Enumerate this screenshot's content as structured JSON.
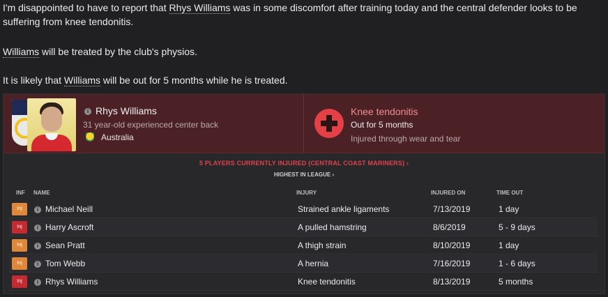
{
  "message": {
    "p1_before": "I'm disappointed to have to report that ",
    "p1_player": "Rhys Williams",
    "p1_after": " was in some discomfort after training today and the central defender looks to be suffering from knee tendonitis.",
    "p2_player": "Williams",
    "p2_after": " will be treated by the club's physios.",
    "p3_before": "It is likely that ",
    "p3_player": "Williams",
    "p3_after": " will be out for 5 months while he is treated."
  },
  "player": {
    "name": "Rhys Williams",
    "description": "31 year-old experienced center back",
    "nationality": "Australia",
    "photo_icon": "player-photo",
    "crest_icon": "club-crest"
  },
  "injury": {
    "title": "Knee tendonitis",
    "duration": "Out for 5 months",
    "cause": "Injured through wear and tear",
    "icon": "medical-cross-icon"
  },
  "squad": {
    "injured_count_label": "5 PLAYERS CURRENTLY INJURED (CENTRAL COAST MARINERS)",
    "chevron": "›",
    "league_label": "HIGHEST IN LEAGUE",
    "columns": {
      "inf": "INF",
      "name": "NAME",
      "injury": "INJURY",
      "injured_on": "INJURED ON",
      "time_out": "TIME OUT"
    },
    "rows": [
      {
        "badge": "Inj",
        "badge_color": "#e0883a",
        "name": "Michael Neill",
        "injury": "Strained ankle ligaments",
        "injured_on": "7/13/2019",
        "time_out": "1 day"
      },
      {
        "badge": "Inj",
        "badge_color": "#c42a30",
        "name": "Harry Ascroft",
        "injury": "A pulled hamstring",
        "injured_on": "8/6/2019",
        "time_out": "5 - 9 days"
      },
      {
        "badge": "Inj",
        "badge_color": "#e0883a",
        "name": "Sean Pratt",
        "injury": "A thigh strain",
        "injured_on": "8/10/2019",
        "time_out": "1 day"
      },
      {
        "badge": "Inj",
        "badge_color": "#e0883a",
        "name": "Tom Webb",
        "injury": "A hernia",
        "injured_on": "7/16/2019",
        "time_out": "1 - 6 days"
      },
      {
        "badge": "Inj",
        "badge_color": "#c42a30",
        "name": "Rhys Williams",
        "injury": "Knee tendonitis",
        "injured_on": "8/13/2019",
        "time_out": "5 months"
      }
    ]
  }
}
